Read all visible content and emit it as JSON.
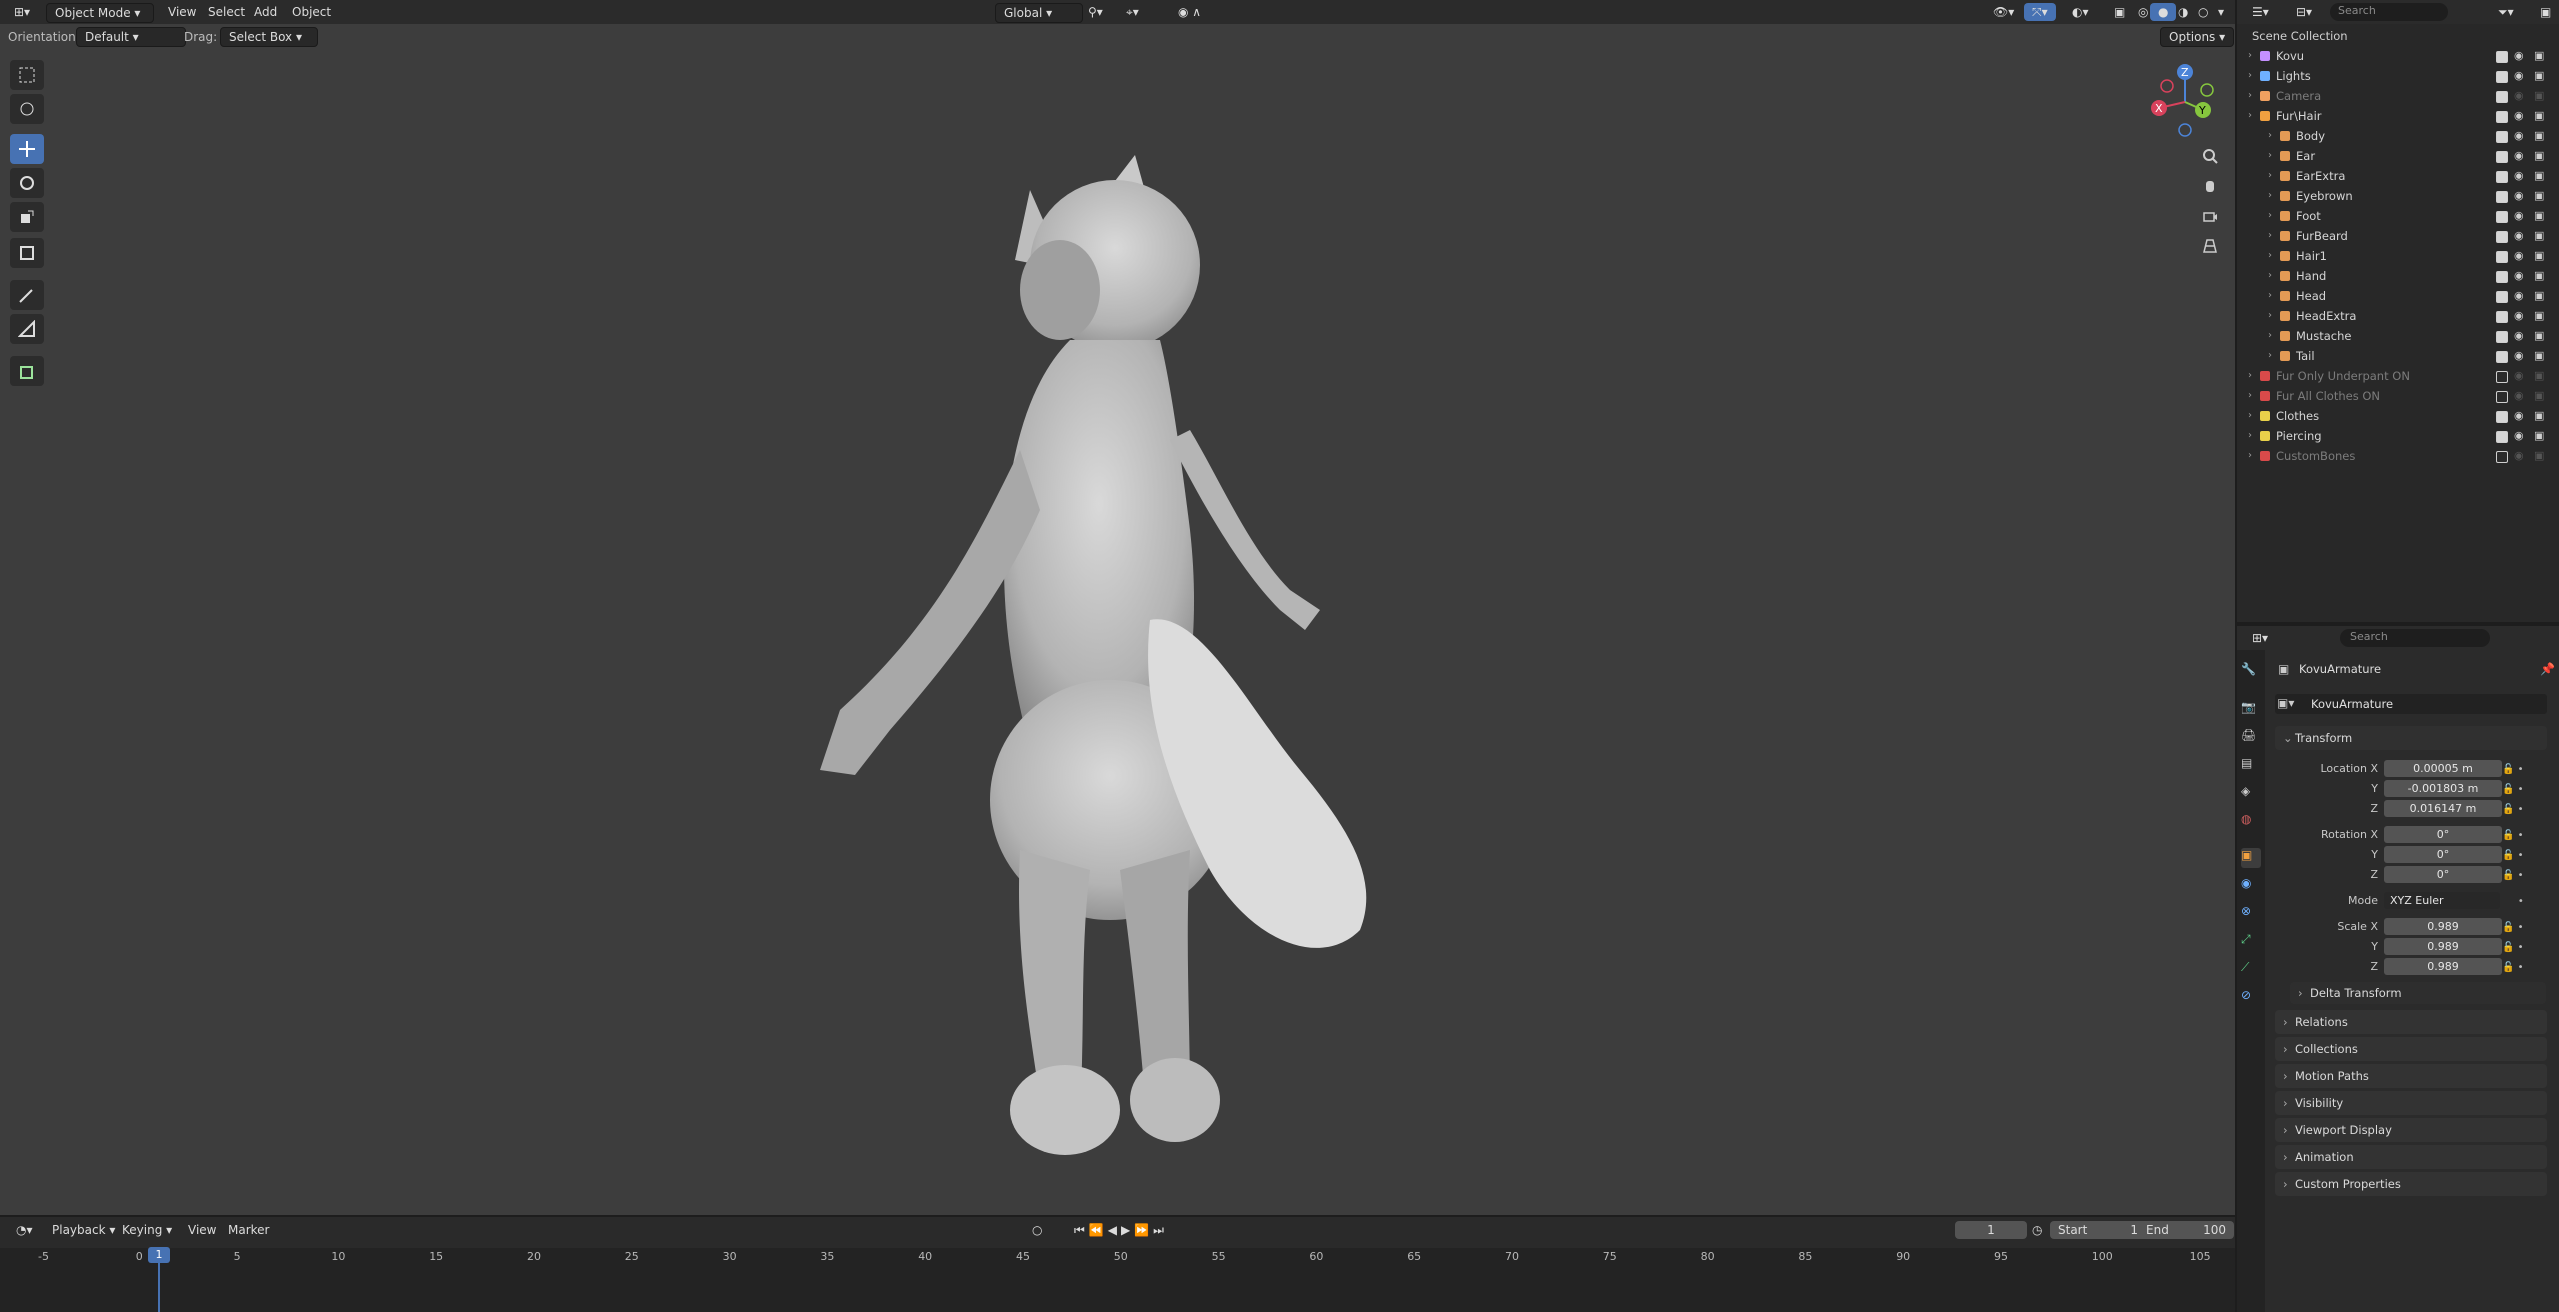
{
  "header": {
    "mode": "Object Mode",
    "menus": [
      "View",
      "Select",
      "Add",
      "Object"
    ],
    "transform_orientation": "Global",
    "search_placeholder": "Search"
  },
  "subheader": {
    "orientation_label": "Orientation:",
    "orientation_value": "Default",
    "drag_label": "Drag:",
    "drag_value": "Select Box",
    "options": "Options"
  },
  "gizmo": {
    "x": "X",
    "y": "Y",
    "z": "Z"
  },
  "outliner": {
    "root": "Scene Collection",
    "items": [
      {
        "name": "Kovu",
        "color": "#c490ff",
        "dim": false,
        "checked": true,
        "sub": "2"
      },
      {
        "name": "Lights",
        "color": "#6fb1ff",
        "dim": false,
        "checked": true,
        "sub": "2"
      },
      {
        "name": "Camera",
        "color": "#f0a060",
        "dim": true,
        "checked": true,
        "sub": ""
      },
      {
        "name": "Fur\\Hair",
        "color": "#f0a040",
        "dim": false,
        "checked": true,
        "sub": ""
      },
      {
        "name": "Body",
        "color": "#e39a55",
        "dim": false,
        "checked": true,
        "sub": ""
      },
      {
        "name": "Ear",
        "color": "#e39a55",
        "dim": false,
        "checked": true,
        "sub": ""
      },
      {
        "name": "EarExtra",
        "color": "#e39a55",
        "dim": false,
        "checked": true,
        "sub": ""
      },
      {
        "name": "Eyebrown",
        "color": "#e39a55",
        "dim": false,
        "checked": true,
        "sub": ""
      },
      {
        "name": "Foot",
        "color": "#e39a55",
        "dim": false,
        "checked": true,
        "sub": ""
      },
      {
        "name": "FurBeard",
        "color": "#e39a55",
        "dim": false,
        "checked": true,
        "sub": ""
      },
      {
        "name": "Hair1",
        "color": "#e39a55",
        "dim": false,
        "checked": true,
        "sub": ""
      },
      {
        "name": "Hand",
        "color": "#e39a55",
        "dim": false,
        "checked": true,
        "sub": ""
      },
      {
        "name": "Head",
        "color": "#e39a55",
        "dim": false,
        "checked": true,
        "sub": ""
      },
      {
        "name": "HeadExtra",
        "color": "#e39a55",
        "dim": false,
        "checked": true,
        "sub": ""
      },
      {
        "name": "Mustache",
        "color": "#e39a55",
        "dim": false,
        "checked": true,
        "sub": ""
      },
      {
        "name": "Tail",
        "color": "#e39a55",
        "dim": false,
        "checked": true,
        "sub": ""
      },
      {
        "name": "Fur Only Underpant ON",
        "color": "#d84a4a",
        "dim": true,
        "checked": false,
        "sub": ""
      },
      {
        "name": "Fur All Clothes ON",
        "color": "#d84a4a",
        "dim": true,
        "checked": false,
        "sub": ""
      },
      {
        "name": "Clothes",
        "color": "#e8d04a",
        "dim": false,
        "checked": true,
        "sub": "3"
      },
      {
        "name": "Piercing",
        "color": "#e8d04a",
        "dim": false,
        "checked": true,
        "sub": ""
      },
      {
        "name": "CustomBones",
        "color": "#d84a4a",
        "dim": true,
        "checked": false,
        "sub": ""
      }
    ]
  },
  "properties": {
    "search_placeholder": "Search",
    "object_name": "KovuArmature",
    "object_field": "KovuArmature",
    "transform_title": "Transform",
    "location_label": "Location X",
    "y_label": "Y",
    "z_label": "Z",
    "location": [
      "0.00005 m",
      "-0.001803 m",
      "0.016147 m"
    ],
    "rotation_label": "Rotation X",
    "rotation": [
      "0°",
      "0°",
      "0°"
    ],
    "mode_label": "Mode",
    "mode_value": "XYZ Euler",
    "scale_label": "Scale X",
    "scale": [
      "0.989",
      "0.989",
      "0.989"
    ],
    "delta": "Delta Transform",
    "panels": [
      "Relations",
      "Collections",
      "Motion Paths",
      "Visibility",
      "Viewport Display",
      "Animation",
      "Custom Properties"
    ]
  },
  "timeline": {
    "menus": [
      "Playback",
      "Keying",
      "View",
      "Marker"
    ],
    "current_frame": "1",
    "start_label": "Start",
    "start": "1",
    "end_label": "End",
    "end": "100",
    "ticks": [
      "-5",
      "0",
      "5",
      "10",
      "15",
      "20",
      "25",
      "30",
      "35",
      "40",
      "45",
      "50",
      "55",
      "60",
      "65",
      "70",
      "75",
      "80",
      "85",
      "90",
      "95",
      "100",
      "105"
    ],
    "playhead": "1"
  }
}
